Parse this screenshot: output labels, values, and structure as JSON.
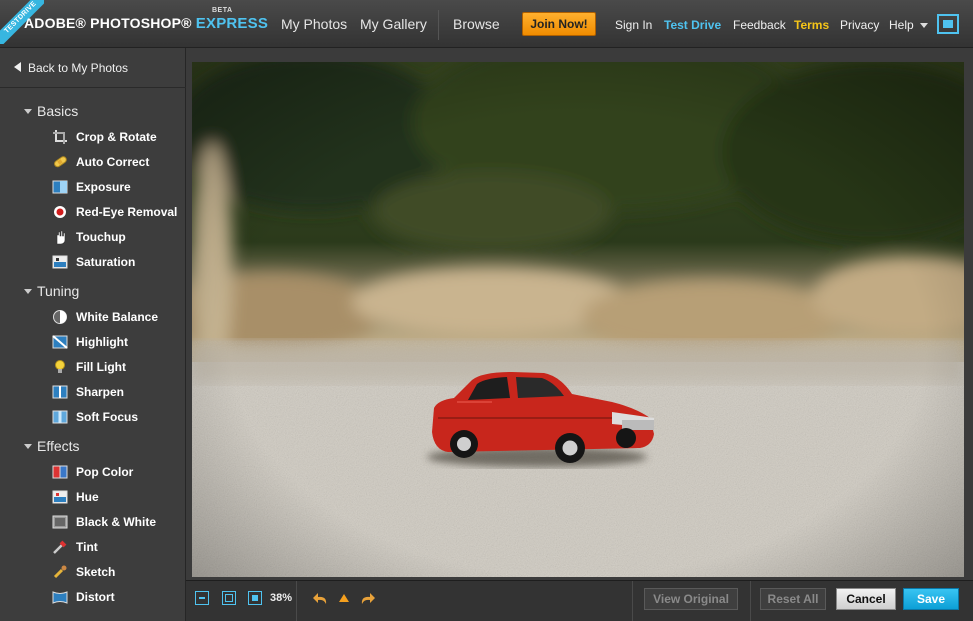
{
  "header": {
    "ribbon": "TESTDRIVE",
    "brand_adobe": "ADOBE® ",
    "brand_photoshop": "PHOTOSHOP® ",
    "brand_express": "EXPRESS",
    "brand_beta": "BETA",
    "nav": {
      "my_photos": "My Photos",
      "my_gallery": "My Gallery",
      "browse": "Browse"
    },
    "join_now": "Join Now!",
    "sign_in": "Sign In",
    "test_drive": "Test Drive",
    "feedback": "Feedback",
    "terms": "Terms",
    "privacy": "Privacy",
    "help": "Help",
    "colors": {
      "accent": "#4fc3f0",
      "terms": "#f5c518",
      "join": "#f5a01e"
    }
  },
  "sidebar": {
    "back": "Back to My Photos",
    "sections": [
      {
        "title": "Basics",
        "tools": [
          {
            "label": "Crop & Rotate",
            "icon": "crop-icon"
          },
          {
            "label": "Auto Correct",
            "icon": "bandage-icon"
          },
          {
            "label": "Exposure",
            "icon": "exposure-icon"
          },
          {
            "label": "Red-Eye Removal",
            "icon": "red-eye-icon"
          },
          {
            "label": "Touchup",
            "icon": "hand-icon"
          },
          {
            "label": "Saturation",
            "icon": "saturation-icon"
          }
        ]
      },
      {
        "title": "Tuning",
        "tools": [
          {
            "label": "White Balance",
            "icon": "white-balance-icon"
          },
          {
            "label": "Highlight",
            "icon": "highlight-icon"
          },
          {
            "label": "Fill Light",
            "icon": "bulb-icon"
          },
          {
            "label": "Sharpen",
            "icon": "sharpen-icon"
          },
          {
            "label": "Soft Focus",
            "icon": "soft-focus-icon"
          }
        ]
      },
      {
        "title": "Effects",
        "tools": [
          {
            "label": "Pop Color",
            "icon": "pop-color-icon"
          },
          {
            "label": "Hue",
            "icon": "hue-icon"
          },
          {
            "label": "Black & White",
            "icon": "black-white-icon"
          },
          {
            "label": "Tint",
            "icon": "dropper-icon"
          },
          {
            "label": "Sketch",
            "icon": "brush-icon"
          },
          {
            "label": "Distort",
            "icon": "distort-icon"
          }
        ]
      }
    ]
  },
  "bottom": {
    "zoom": "38%",
    "view_original": "View Original",
    "reset_all": "Reset All",
    "cancel": "Cancel",
    "save": "Save"
  }
}
